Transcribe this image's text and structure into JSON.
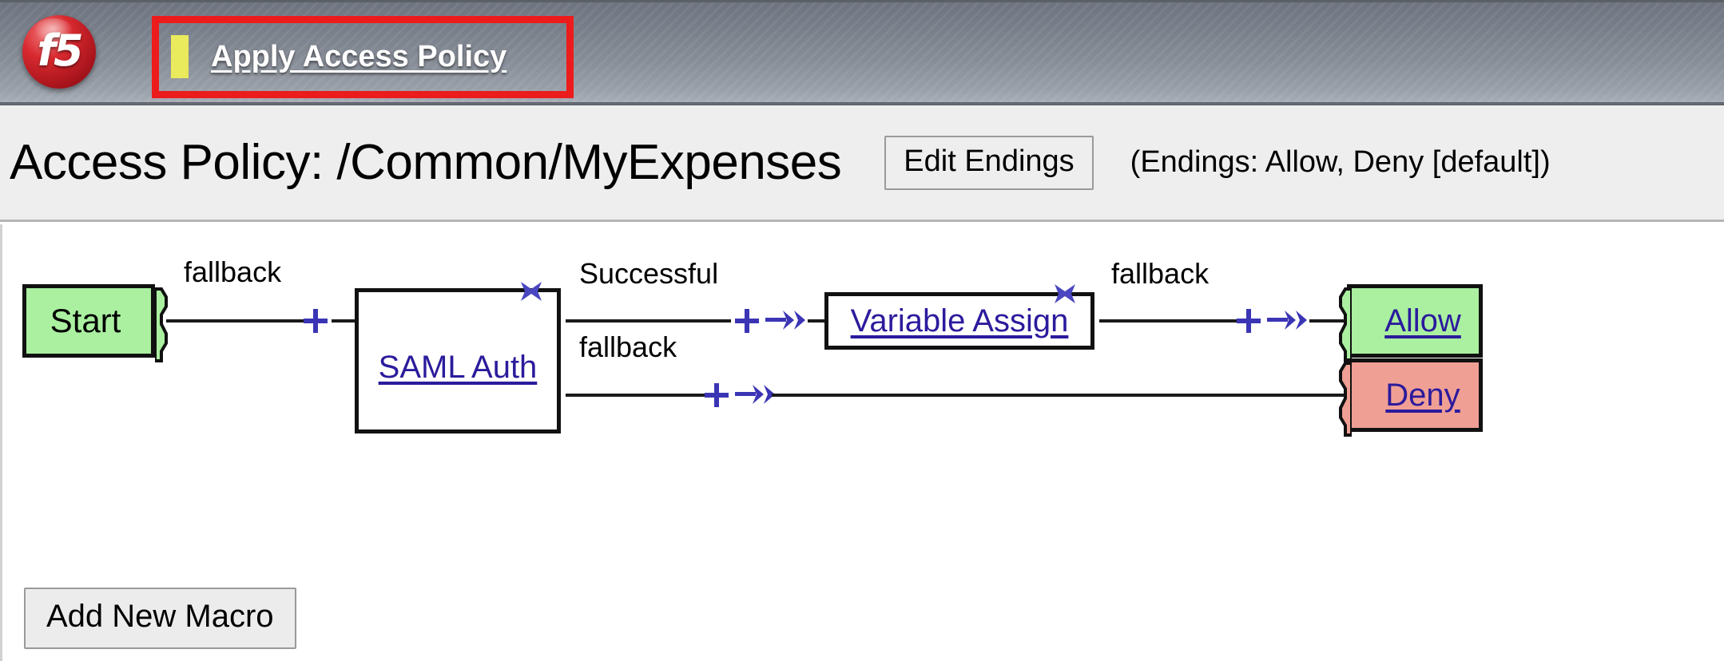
{
  "navbar": {
    "logo_text": "f5",
    "apply_policy_label": "Apply Access Policy",
    "status_indicator_color": "#e9ea5c",
    "highlight_color": "#ec1c1c"
  },
  "header": {
    "page_title": "Access Policy: /Common/MyExpenses",
    "edit_endings_label": "Edit Endings",
    "endings_note": "(Endings: Allow, Deny [default])"
  },
  "policy": {
    "start_node": {
      "label": "Start",
      "color": "#aaf0a0"
    },
    "items": [
      {
        "label": "SAML Auth"
      },
      {
        "label": "Variable Assign"
      }
    ],
    "branches": [
      {
        "label": "fallback"
      },
      {
        "label": "Successful"
      },
      {
        "label": "fallback"
      },
      {
        "label": "fallback"
      }
    ],
    "endings": [
      {
        "label": "Allow",
        "color": "#aaf0a0"
      },
      {
        "label": "Deny",
        "color": "#ef9f94"
      }
    ],
    "icons": {
      "add": "plus-icon",
      "insert_macro": "arrow-chevron-icon",
      "delete": "delete-x-icon"
    },
    "link_color": "#2b1b9c",
    "icon_color": "#3b35b5"
  },
  "footer": {
    "add_new_macro_label": "Add New Macro"
  }
}
